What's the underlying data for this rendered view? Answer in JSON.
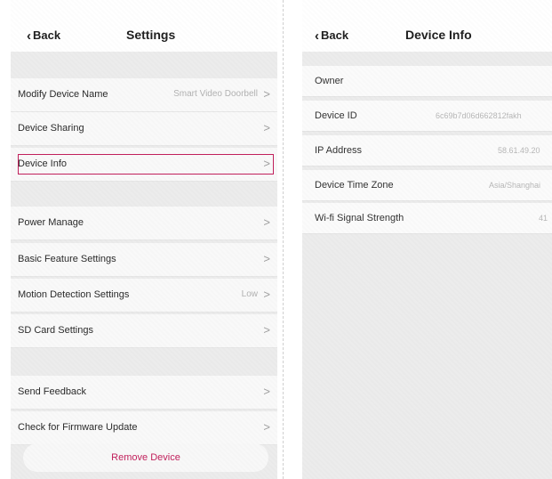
{
  "settings": {
    "back_label": "Back",
    "title": "Settings",
    "rows": [
      {
        "label": "Modify Device Name",
        "value": "Smart Video Doorbell"
      },
      {
        "label": "Device Sharing",
        "value": ""
      },
      {
        "label": "Device Info",
        "value": ""
      },
      {
        "label": "Power Manage",
        "value": ""
      },
      {
        "label": "Basic Feature Settings",
        "value": ""
      },
      {
        "label": "Motion Detection Settings",
        "value": "Low"
      },
      {
        "label": "SD Card Settings",
        "value": ""
      },
      {
        "label": "Send Feedback",
        "value": ""
      },
      {
        "label": "Check for Firmware Update",
        "value": ""
      }
    ],
    "remove_label": "Remove Device",
    "chevron": ">"
  },
  "device_info": {
    "back_label": "Back",
    "title": "Device Info",
    "rows": [
      {
        "label": "Owner",
        "value": ""
      },
      {
        "label": "Device ID",
        "value": "6c69b7d06d662812fakh"
      },
      {
        "label": "IP Address",
        "value": "58.61.49.20"
      },
      {
        "label": "Device Time Zone",
        "value": "Asia/Shanghai"
      },
      {
        "label": "Wi-fi Signal Strength",
        "value": "41"
      }
    ]
  },
  "colors": {
    "accent": "#c2205c",
    "background": "#ececec",
    "row": "#f9f9f9"
  }
}
